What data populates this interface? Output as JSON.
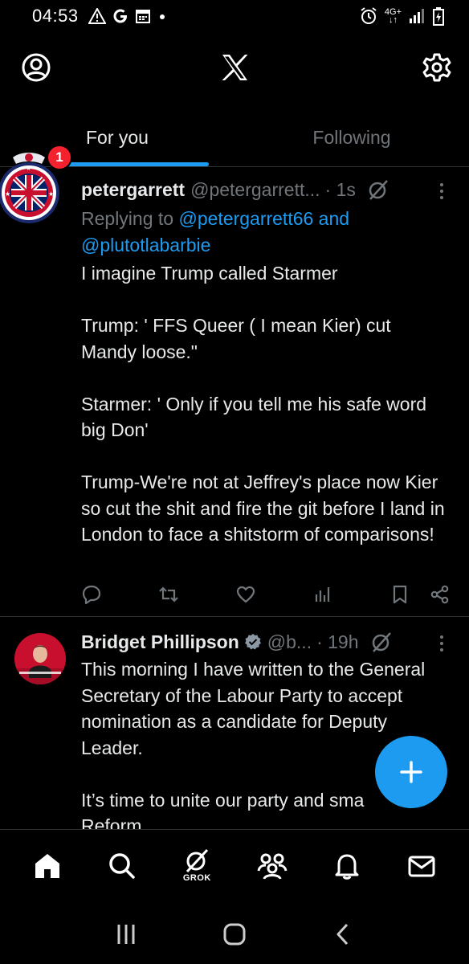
{
  "status_bar": {
    "time": "04:53",
    "left_icons": [
      "warning-icon",
      "google-icon",
      "calendar-icon",
      "dot-icon"
    ],
    "right_icons": [
      "alarm-icon",
      "network-4g-icon",
      "signal-icon",
      "battery-icon"
    ],
    "network_label": "4G+"
  },
  "top_bar": {
    "icons": [
      "profile-icon",
      "x-logo-icon",
      "settings-icon"
    ]
  },
  "tabs": [
    {
      "label": "For you",
      "active": true
    },
    {
      "label": "Following",
      "active": false
    }
  ],
  "tweets": [
    {
      "author": "petergarrett",
      "handle": "@petergarrett...",
      "time": "· 1s",
      "badge_count": "1",
      "replying_prefix": "Replying to ",
      "replying_user1": "@petergarrett66",
      "replying_and": " and",
      "replying_user2": "@plutotlabarbie",
      "text": "I imagine Trump called Starmer\n\nTrump: ' FFS Queer ( I mean Kier) cut Mandy loose.\"\n\nStarmer: ' Only if you tell me his safe word big Don'\n\nTrump-We're not at Jeffrey's place now Kier so cut the shit and fire the git before I land in London to face a shitstorm of comparisons!",
      "actions": [
        "reply-icon",
        "retweet-icon",
        "like-icon",
        "views-icon",
        "bookmark-icon",
        "share-icon"
      ]
    },
    {
      "author": "Bridget Phillipson",
      "handle": "@b...",
      "time": "· 19h",
      "verified": true,
      "text": "This morning I have written to the General Secretary of the Labour Party to accept nomination as a candidate for Deputy Leader.\n\nIt’s time to unite our party and sma\nReform."
    }
  ],
  "fab": {
    "icon": "plus-icon"
  },
  "bottom_nav": {
    "items": [
      "home-icon",
      "search-icon",
      "grok-icon",
      "communities-icon",
      "notifications-icon",
      "messages-icon"
    ],
    "grok_label": "GROK"
  },
  "system_nav": [
    "recents-icon",
    "home-button-icon",
    "back-icon"
  ],
  "colors": {
    "background": "#000000",
    "text": "#e7e9ea",
    "muted": "#71767b",
    "accent": "#1d9bf0",
    "badge": "#f4212e",
    "divider": "#2f3336"
  }
}
